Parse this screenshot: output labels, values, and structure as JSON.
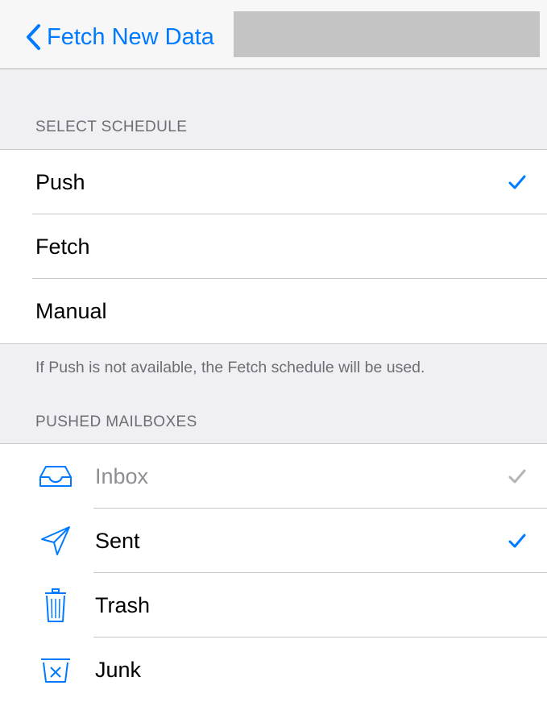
{
  "navbar": {
    "back_label": "Fetch New Data"
  },
  "schedule": {
    "header": "SELECT SCHEDULE",
    "items": [
      {
        "label": "Push",
        "selected": true
      },
      {
        "label": "Fetch",
        "selected": false
      },
      {
        "label": "Manual",
        "selected": false
      }
    ],
    "footer": "If Push is not available, the Fetch schedule will be used."
  },
  "mailboxes": {
    "header": "PUSHED MAILBOXES",
    "items": [
      {
        "label": "Inbox",
        "icon": "inbox-icon",
        "checked": true,
        "disabled": true
      },
      {
        "label": "Sent",
        "icon": "sent-icon",
        "checked": true,
        "disabled": false
      },
      {
        "label": "Trash",
        "icon": "trash-icon",
        "checked": false,
        "disabled": false
      },
      {
        "label": "Junk",
        "icon": "junk-icon",
        "checked": false,
        "disabled": false
      }
    ]
  },
  "colors": {
    "accent": "#007aff",
    "disabled": "#8e8e93",
    "background": "#efeff4"
  }
}
